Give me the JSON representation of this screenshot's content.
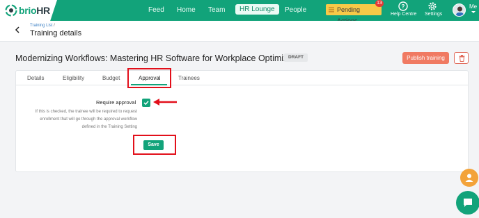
{
  "app": {
    "logo_brand": "brio",
    "logo_suffix": "HR"
  },
  "nav": {
    "items": [
      "Feed",
      "Home",
      "Team",
      "HR Lounge",
      "People"
    ],
    "active": "HR Lounge",
    "pending_label": "Pending Actions",
    "pending_count": "13",
    "help_label": "Help Centre",
    "settings_label": "Settings",
    "me_label": "Me"
  },
  "header": {
    "breadcrumb": "Training List",
    "breadcrumb_sep": "/",
    "title": "Training details"
  },
  "training": {
    "title": "Modernizing Workflows: Mastering HR Software for Workplace Optimization",
    "status": "DRAFT",
    "publish_label": "Publish training"
  },
  "tabs": [
    "Details",
    "Eligibility",
    "Budget",
    "Approval",
    "Trainees"
  ],
  "active_tab": "Approval",
  "approval": {
    "label": "Require approval",
    "description": "If this is checked, the trainee will be required to request enrollment that will go through the approval workflow defined in the Training Setting",
    "checked": true,
    "save_label": "Save"
  },
  "colors": {
    "brand": "#12a37a",
    "accent": "#f07a62",
    "pending": "#f7c948",
    "highlight": "#e20f1a"
  }
}
